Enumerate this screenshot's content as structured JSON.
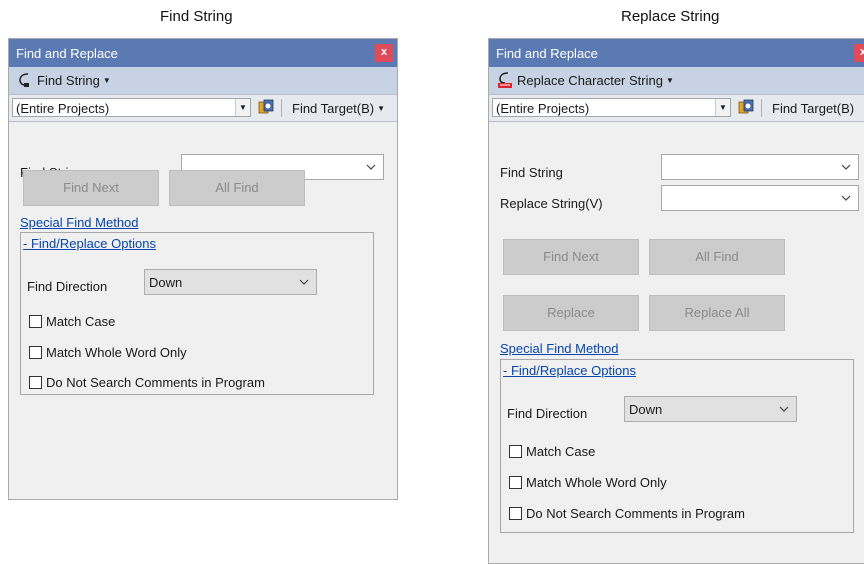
{
  "captions": {
    "left": "Find String",
    "right": "Replace String"
  },
  "find_panel": {
    "title": "Find and Replace",
    "close": "x",
    "mode_label": "Find String",
    "scope_value": "(Entire Projects)",
    "find_target_label": "Find Target(B)",
    "find_string_label": "Find String",
    "find_string_value": "",
    "find_next_label": "Find Next",
    "all_find_label": "All Find",
    "special_find_link": "Special Find Method",
    "options_link": "- Find/Replace Options",
    "direction_label": "Find Direction",
    "direction_value": "Down",
    "match_case_label": "Match Case",
    "match_case_checked": false,
    "whole_word_label": "Match Whole Word Only",
    "whole_word_checked": false,
    "no_comments_label": "Do Not Search Comments in Program",
    "no_comments_checked": false
  },
  "replace_panel": {
    "title": "Find and Replace",
    "close": "x",
    "mode_label": "Replace Character String",
    "scope_value": "(Entire Projects)",
    "find_target_label": "Find Target(B)",
    "find_string_label": "Find String",
    "find_string_value": "",
    "replace_string_label": "Replace String(V)",
    "replace_string_value": "",
    "find_next_label": "Find Next",
    "all_find_label": "All Find",
    "replace_label": "Replace",
    "replace_all_label": "Replace All",
    "special_find_link": "Special Find Method",
    "options_link": "- Find/Replace Options",
    "direction_label": "Find Direction",
    "direction_value": "Down",
    "match_case_label": "Match Case",
    "match_case_checked": false,
    "whole_word_label": "Match Whole Word Only",
    "whole_word_checked": false,
    "no_comments_label": "Do Not Search Comments in Program",
    "no_comments_checked": false
  },
  "colors": {
    "titlebar": "#5b7ab3",
    "modebar": "#c7d2e4",
    "close_button": "#e04b5a",
    "link": "#0645ad",
    "disabled_button": "#cccccc",
    "replace_icon_accent": "#d7262e"
  },
  "icons": {
    "find_mode": "find-string-icon",
    "replace_mode": "replace-string-icon",
    "find_target": "find-target-icon",
    "dropdown": "chevron-down-icon"
  }
}
